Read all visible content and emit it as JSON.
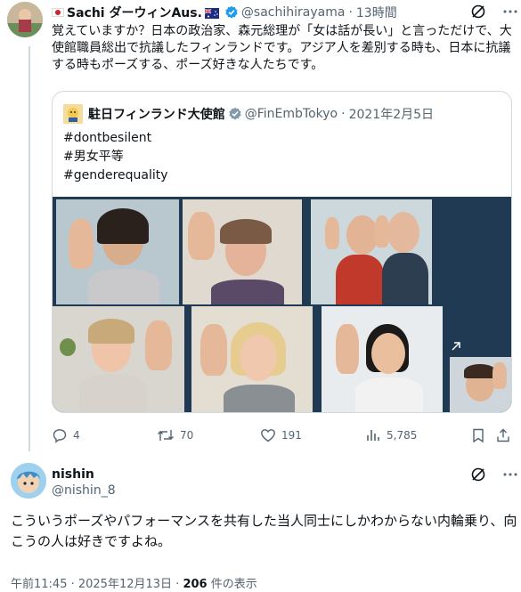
{
  "quoting_tweet": {
    "display_name": "Sachi ダーウィンAus.",
    "handle": "@sachihirayama",
    "separator": "·",
    "time": "13時間",
    "text": "覚えていますか？日本の政治家、森元総理が「女は話が長い」と言っただけで、大使館職員総出で抗議したフィンランドです。アジア人を差別する時も、日本に抗議する時もポーズする、ポーズ好きな人たちです。"
  },
  "quoted_tweet": {
    "display_name": "駐日フィンランド大使館",
    "handle": "@FinEmbTokyo",
    "separator": "·",
    "date": "2021年2月5日",
    "hashtags": [
      "#dontbesilent",
      "#男女平等",
      "#genderequality"
    ]
  },
  "actions": {
    "replies": "4",
    "retweets": "70",
    "likes": "191",
    "views": "5,785"
  },
  "reply_tweet": {
    "display_name": "nishin",
    "handle": "@nishin_8",
    "text": "こういうポーズやパフォーマンスを共有した当人同士にしかわからない内輪乗り、向こうの人は好きですよね。",
    "timestamp": "午前11:45 · 2025年12月13日 · ",
    "view_count": "206",
    "views_label": " 件の表示"
  },
  "icons": {
    "verified": "verified-badge-icon",
    "grok": "grok-icon",
    "more": "more-icon",
    "reply": "reply-icon",
    "retweet": "retweet-icon",
    "like": "like-icon",
    "views": "views-icon",
    "bookmark": "bookmark-icon",
    "share": "share-icon"
  },
  "colors": {
    "text": "#0f1419",
    "muted": "#536471",
    "verified": "#1d9bf0",
    "border": "#cfd9de"
  }
}
